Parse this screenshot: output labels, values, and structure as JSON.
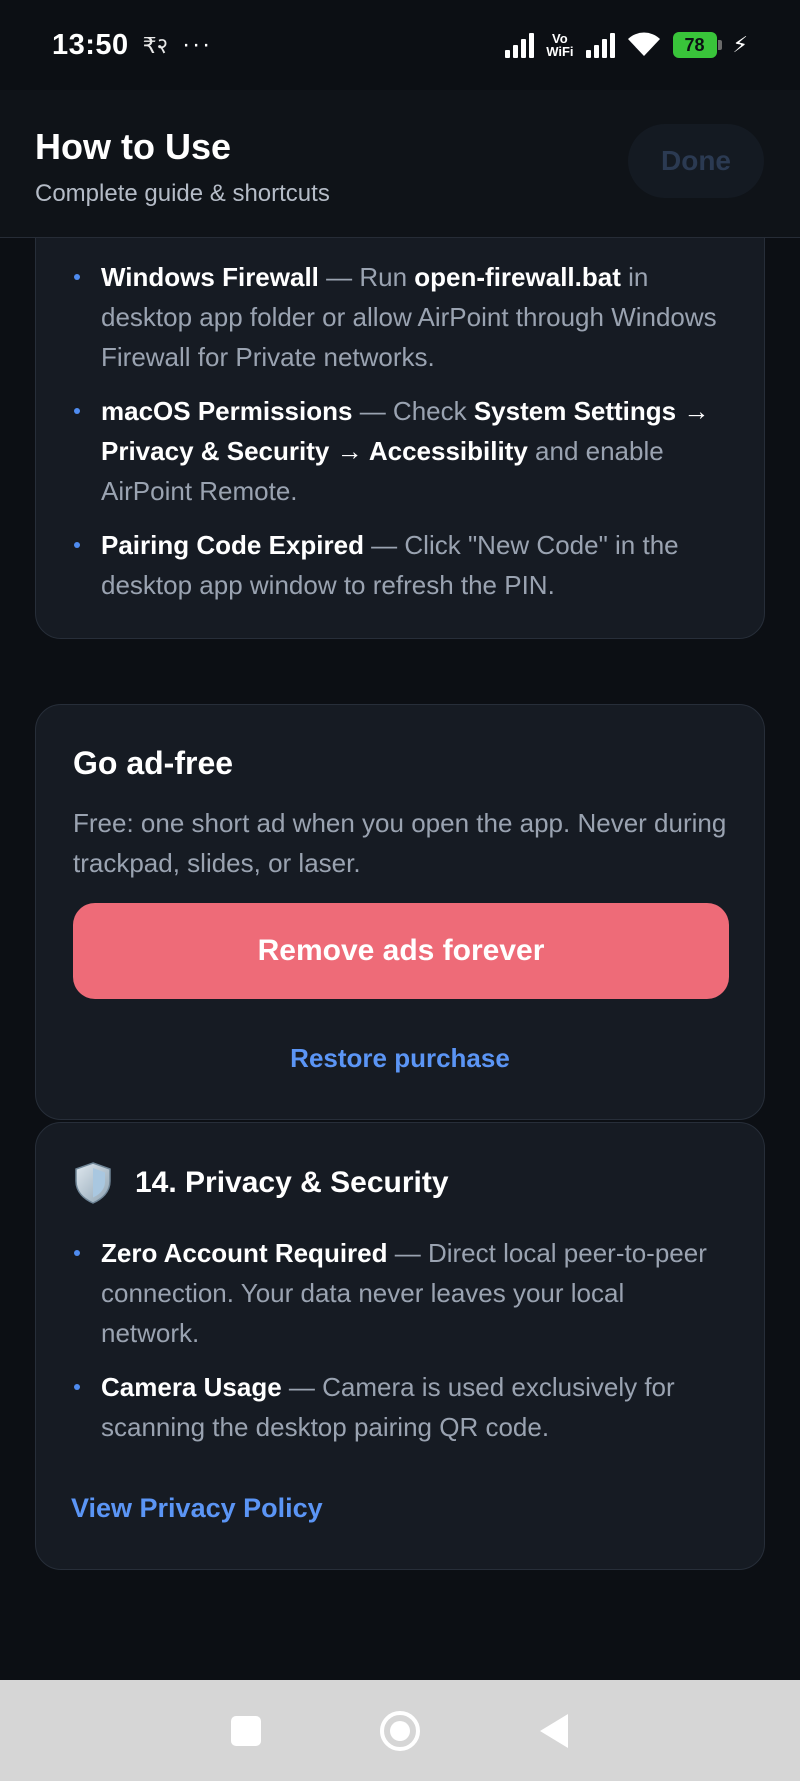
{
  "status_bar": {
    "time": "13:50",
    "carrier_glyph": "₹२",
    "dots": "···",
    "vowifi_top": "Vo",
    "vowifi_bottom": "WiFi",
    "battery": "78"
  },
  "header": {
    "title": "How to Use",
    "subtitle": "Complete guide & shortcuts",
    "done_label": "Done"
  },
  "troubleshooting": {
    "items": [
      {
        "title": "Windows Firewall",
        "sep": " — Run ",
        "code": "open-firewall.bat",
        "text": " in desktop app folder or allow AirPoint through Windows Firewall for Private networks."
      },
      {
        "title": "macOS Permissions",
        "sep": " — Check ",
        "path1": "System Settings → Privacy & Security → Accessibility",
        "text": " and enable AirPoint Remote."
      },
      {
        "title": "Pairing Code Expired",
        "text": " — Click \"New Code\" in the desktop app window to refresh the PIN."
      }
    ]
  },
  "ad_free": {
    "title": "Go ad-free",
    "description": "Free: one short ad when you open the app. Never during trackpad, slides, or laser.",
    "remove_button": "Remove ads forever",
    "restore_link": "Restore purchase"
  },
  "privacy": {
    "icon": "shield-icon",
    "title": "14. Privacy & Security",
    "items": [
      {
        "title": "Zero Account Required",
        "text": " — Direct local peer-to-peer connection. Your data never leaves your local network."
      },
      {
        "title": "Camera Usage",
        "text": " — Camera is used exclusively for scanning the desktop pairing QR code."
      }
    ],
    "policy_link": "View Privacy Policy"
  },
  "colors": {
    "accent": "#5b95f5",
    "cta": "#ee6b78",
    "card": "#161b23",
    "background": "#0c0f14"
  }
}
